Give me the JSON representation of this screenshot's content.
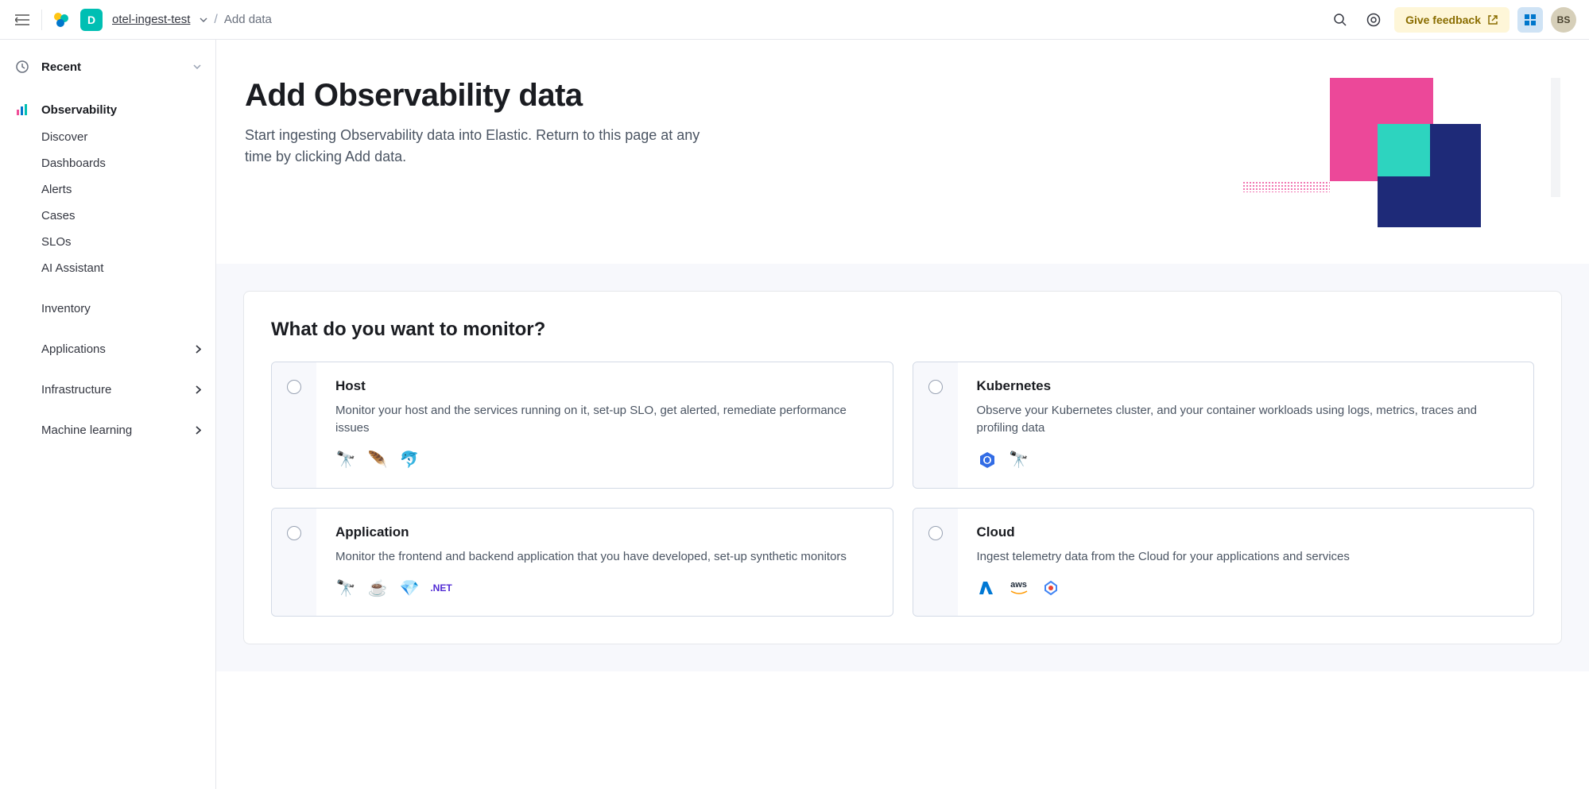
{
  "header": {
    "space_letter": "D",
    "breadcrumb_project": "otel-ingest-test",
    "breadcrumb_current": "Add data",
    "feedback_label": "Give feedback",
    "avatar_initials": "BS"
  },
  "sidebar": {
    "recent_label": "Recent",
    "observability_label": "Observability",
    "items": {
      "discover": "Discover",
      "dashboards": "Dashboards",
      "alerts": "Alerts",
      "cases": "Cases",
      "slos": "SLOs",
      "ai_assistant": "AI Assistant",
      "inventory": "Inventory",
      "applications": "Applications",
      "infrastructure": "Infrastructure",
      "machine_learning": "Machine learning"
    }
  },
  "page": {
    "title": "Add Observability data",
    "subtitle": "Start ingesting Observability data into Elastic. Return to this page at any time by clicking Add data."
  },
  "monitor": {
    "heading": "What do you want to monitor?",
    "options": {
      "host": {
        "title": "Host",
        "desc": "Monitor your host and the services running on it, set-up SLO, get alerted, remediate performance issues"
      },
      "kubernetes": {
        "title": "Kubernetes",
        "desc": "Observe your Kubernetes cluster, and your container workloads using logs, metrics, traces and profiling data"
      },
      "application": {
        "title": "Application",
        "desc": "Monitor the frontend and backend application that you have developed, set-up synthetic monitors",
        "dotnet_label": ".NET"
      },
      "cloud": {
        "title": "Cloud",
        "desc": "Ingest telemetry data from the Cloud for your applications and services",
        "aws_label": "aws"
      }
    }
  }
}
